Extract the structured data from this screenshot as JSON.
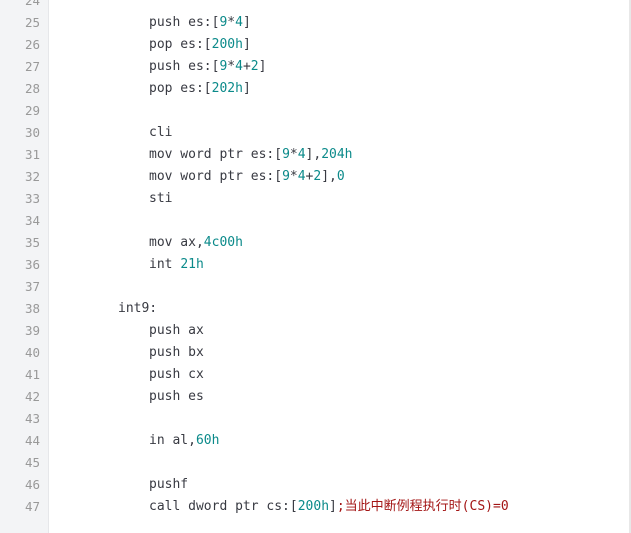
{
  "colors": {
    "gutter_bg": "#f3f4f6",
    "line_number": "#999999",
    "code_text": "#383a42",
    "numeric_literal": "#0b8a8a",
    "comment_text": "#a31515"
  },
  "lines": [
    {
      "num": "24",
      "indent": 0,
      "tokens": []
    },
    {
      "num": "25",
      "indent": 12,
      "tokens": [
        {
          "t": "push es:[",
          "c": "plain"
        },
        {
          "t": "9",
          "c": "num"
        },
        {
          "t": "*",
          "c": "plain"
        },
        {
          "t": "4",
          "c": "num"
        },
        {
          "t": "]",
          "c": "plain"
        }
      ]
    },
    {
      "num": "26",
      "indent": 12,
      "tokens": [
        {
          "t": "pop es:[",
          "c": "plain"
        },
        {
          "t": "200h",
          "c": "num"
        },
        {
          "t": "]",
          "c": "plain"
        }
      ]
    },
    {
      "num": "27",
      "indent": 12,
      "tokens": [
        {
          "t": "push es:[",
          "c": "plain"
        },
        {
          "t": "9",
          "c": "num"
        },
        {
          "t": "*",
          "c": "plain"
        },
        {
          "t": "4",
          "c": "num"
        },
        {
          "t": "+",
          "c": "plain"
        },
        {
          "t": "2",
          "c": "num"
        },
        {
          "t": "]",
          "c": "plain"
        }
      ]
    },
    {
      "num": "28",
      "indent": 12,
      "tokens": [
        {
          "t": "pop es:[",
          "c": "plain"
        },
        {
          "t": "202h",
          "c": "num"
        },
        {
          "t": "]",
          "c": "plain"
        }
      ]
    },
    {
      "num": "29",
      "indent": 0,
      "tokens": []
    },
    {
      "num": "30",
      "indent": 12,
      "tokens": [
        {
          "t": "cli",
          "c": "plain"
        }
      ]
    },
    {
      "num": "31",
      "indent": 12,
      "tokens": [
        {
          "t": "mov word ptr es:[",
          "c": "plain"
        },
        {
          "t": "9",
          "c": "num"
        },
        {
          "t": "*",
          "c": "plain"
        },
        {
          "t": "4",
          "c": "num"
        },
        {
          "t": "],",
          "c": "plain"
        },
        {
          "t": "204h",
          "c": "num"
        }
      ]
    },
    {
      "num": "32",
      "indent": 12,
      "tokens": [
        {
          "t": "mov word ptr es:[",
          "c": "plain"
        },
        {
          "t": "9",
          "c": "num"
        },
        {
          "t": "*",
          "c": "plain"
        },
        {
          "t": "4",
          "c": "num"
        },
        {
          "t": "+",
          "c": "plain"
        },
        {
          "t": "2",
          "c": "num"
        },
        {
          "t": "],",
          "c": "plain"
        },
        {
          "t": "0",
          "c": "num"
        }
      ]
    },
    {
      "num": "33",
      "indent": 12,
      "tokens": [
        {
          "t": "sti",
          "c": "plain"
        }
      ]
    },
    {
      "num": "34",
      "indent": 0,
      "tokens": []
    },
    {
      "num": "35",
      "indent": 12,
      "tokens": [
        {
          "t": "mov ax,",
          "c": "plain"
        },
        {
          "t": "4c00h",
          "c": "num"
        }
      ]
    },
    {
      "num": "36",
      "indent": 12,
      "tokens": [
        {
          "t": "int ",
          "c": "plain"
        },
        {
          "t": "21h",
          "c": "num"
        }
      ]
    },
    {
      "num": "37",
      "indent": 0,
      "tokens": []
    },
    {
      "num": "38",
      "indent": 8,
      "tokens": [
        {
          "t": "int9:",
          "c": "plain"
        }
      ]
    },
    {
      "num": "39",
      "indent": 12,
      "tokens": [
        {
          "t": "push ax",
          "c": "plain"
        }
      ]
    },
    {
      "num": "40",
      "indent": 12,
      "tokens": [
        {
          "t": "push bx",
          "c": "plain"
        }
      ]
    },
    {
      "num": "41",
      "indent": 12,
      "tokens": [
        {
          "t": "push cx",
          "c": "plain"
        }
      ]
    },
    {
      "num": "42",
      "indent": 12,
      "tokens": [
        {
          "t": "push es",
          "c": "plain"
        }
      ]
    },
    {
      "num": "43",
      "indent": 0,
      "tokens": []
    },
    {
      "num": "44",
      "indent": 12,
      "tokens": [
        {
          "t": "in al,",
          "c": "plain"
        },
        {
          "t": "60h",
          "c": "num"
        }
      ]
    },
    {
      "num": "45",
      "indent": 0,
      "tokens": []
    },
    {
      "num": "46",
      "indent": 12,
      "tokens": [
        {
          "t": "pushf",
          "c": "plain"
        }
      ]
    },
    {
      "num": "47",
      "indent": 12,
      "tokens": [
        {
          "t": "call dword ptr cs:[",
          "c": "plain"
        },
        {
          "t": "200h",
          "c": "num"
        },
        {
          "t": "]",
          "c": "plain"
        },
        {
          "t": ";当此中断例程执行时(CS)=0",
          "c": "comment"
        }
      ]
    }
  ]
}
